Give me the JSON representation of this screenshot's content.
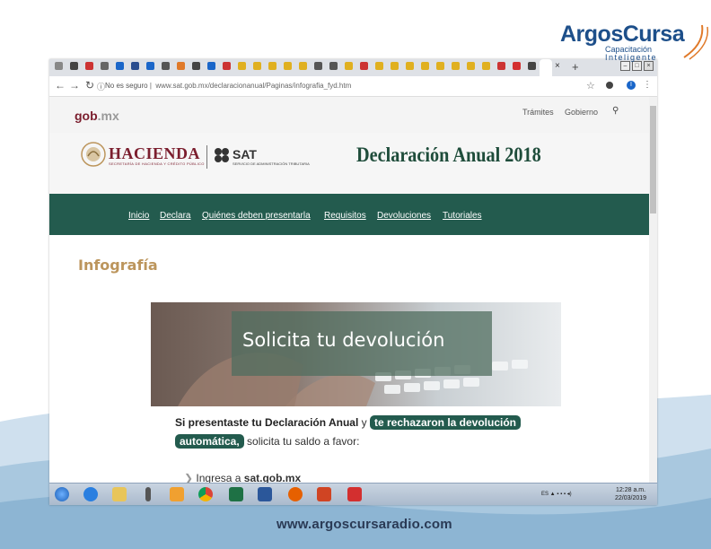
{
  "logo": {
    "brand_a": "Argos",
    "brand_b": "Cursa",
    "sub1": "Capacitación",
    "sub2": "Inteligente"
  },
  "browser": {
    "tab_close": "×",
    "tab_new": "+",
    "url_security": "No es seguro",
    "url": "www.sat.gob.mx/declaracionanual/Paginas/infografia_fyd.htm",
    "profile_initial": "I"
  },
  "site": {
    "gob": "gob",
    "gob_mx": ".mx",
    "top_links": [
      "Trámites",
      "Gobierno"
    ],
    "hacienda": "HACIENDA",
    "hacienda_sub": "SECRETARÍA DE HACIENDA Y CRÉDITO PÚBLICO",
    "sat": "SAT",
    "sat_sub": "SERVICIO DE ADMINISTRACIÓN TRIBUTARIA",
    "page_title": "Declaración Anual 2018",
    "nav": [
      "Inicio",
      "Declara",
      "Quiénes deben presentarla",
      "Requisitos",
      "Devoluciones",
      "Tutoriales"
    ]
  },
  "content": {
    "heading": "Infografía",
    "hero_text": "Solicita tu devolución",
    "p_part1": "Si presentaste tu Declaración Anual",
    "p_y": " y ",
    "p_pill1": "te rechazaron la devolución",
    "p_pill2": "automática,",
    "p_part2": " solicita tu saldo a favor:",
    "ingresa_pre": "Ingresa a ",
    "ingresa_link": "sat.gob.mx"
  },
  "taskbar": {
    "tray": "ES",
    "time": "12:28 a.m.",
    "date": "22/03/2019"
  },
  "footer_url": "www.argoscursaradio.com",
  "colors": {
    "gov_green": "#235b4e",
    "gov_maroon": "#7b1e2e",
    "gov_gold": "#bc955c",
    "brand_blue": "#1d4f8a"
  }
}
